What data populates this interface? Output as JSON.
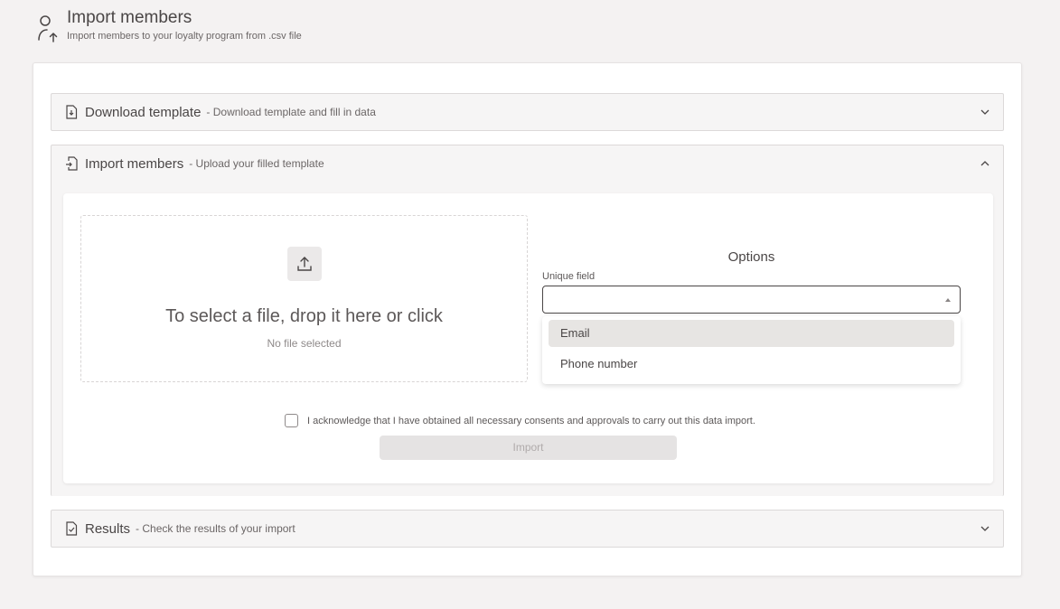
{
  "header": {
    "title": "Import members",
    "subtitle": "Import members to your loyalty program from .csv file",
    "icon": "user-upload-icon"
  },
  "sections": {
    "download": {
      "title": "Download template",
      "description": "- Download template and fill in data",
      "icon": "file-download-icon",
      "state": "collapsed"
    },
    "import": {
      "title": "Import members",
      "description": "- Upload your filled template",
      "icon": "file-import-icon",
      "state": "expanded"
    },
    "results": {
      "title": "Results",
      "description": "- Check the results of your import",
      "icon": "file-check-icon",
      "state": "collapsed"
    }
  },
  "dropzone": {
    "title": "To select a file, drop it here or click",
    "status": "No file selected",
    "icon": "upload-icon"
  },
  "options": {
    "title": "Options",
    "unique_field_label": "Unique field",
    "unique_field_value": "",
    "menu_items": [
      "Email",
      "Phone number"
    ],
    "highlighted_item": "Email"
  },
  "consent": {
    "label": "I acknowledge that I have obtained all necessary consents and approvals to carry out this data import.",
    "checked": false
  },
  "import_button": {
    "label": "Import",
    "enabled": false
  },
  "colors": {
    "background": "#f4f2f2",
    "card": "#ffffff",
    "text": "#4a4646",
    "menu_highlight": "#e7e5e3",
    "disabled_button": "#e5e3e3"
  }
}
